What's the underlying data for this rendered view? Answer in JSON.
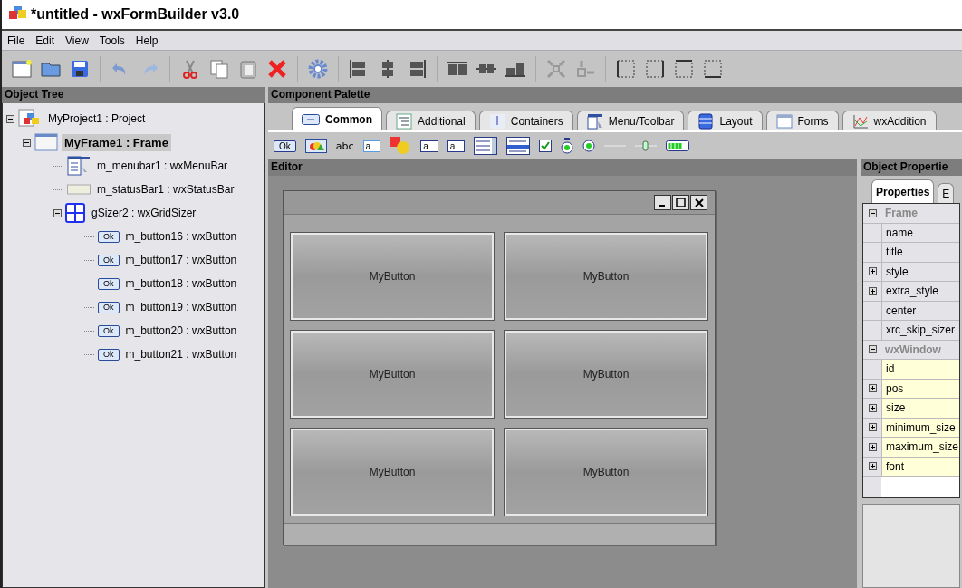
{
  "window": {
    "title": "*untitled - wxFormBuilder v3.0"
  },
  "menu": [
    "File",
    "Edit",
    "View",
    "Tools",
    "Help"
  ],
  "object_tree": {
    "title": "Object Tree",
    "items": [
      {
        "label": "MyProject1 : Project",
        "kind": "project",
        "expanded": true,
        "selected": false,
        "children": [
          {
            "label": "MyFrame1 : Frame",
            "kind": "frame",
            "expanded": true,
            "selected": true,
            "children": [
              {
                "label": "m_menubar1 : wxMenuBar",
                "kind": "menubar",
                "selected": false
              },
              {
                "label": "m_statusBar1 : wxStatusBar",
                "kind": "statusbar",
                "selected": false
              },
              {
                "label": "gSizer2 : wxGridSizer",
                "kind": "sizer",
                "expanded": true,
                "selected": false,
                "children": [
                  {
                    "label": "m_button16 : wxButton",
                    "kind": "button",
                    "badge": "Ok",
                    "selected": false
                  },
                  {
                    "label": "m_button17 : wxButton",
                    "kind": "button",
                    "badge": "Ok",
                    "selected": false
                  },
                  {
                    "label": "m_button18 : wxButton",
                    "kind": "button",
                    "badge": "Ok",
                    "selected": false
                  },
                  {
                    "label": "m_button19 : wxButton",
                    "kind": "button",
                    "badge": "Ok",
                    "selected": false
                  },
                  {
                    "label": "m_button20 : wxButton",
                    "kind": "button",
                    "badge": "Ok",
                    "selected": false
                  },
                  {
                    "label": "m_button21 : wxButton",
                    "kind": "button",
                    "badge": "Ok",
                    "selected": false
                  }
                ]
              }
            ]
          }
        ]
      }
    ]
  },
  "palette": {
    "title": "Component Palette",
    "tabs": [
      {
        "label": "Common",
        "kind": "common",
        "selected": true
      },
      {
        "label": "Additional",
        "kind": "additional",
        "selected": false
      },
      {
        "label": "Containers",
        "kind": "containers",
        "selected": false
      },
      {
        "label": "Menu/Toolbar",
        "kind": "menu",
        "selected": false
      },
      {
        "label": "Layout",
        "kind": "layout",
        "selected": false
      },
      {
        "label": "Forms",
        "kind": "forms",
        "selected": false
      },
      {
        "label": "wxAddition",
        "kind": "additions",
        "selected": false
      }
    ],
    "items": [
      {
        "kind": "button",
        "text": "Ok"
      },
      {
        "kind": "bitmapbutton"
      },
      {
        "kind": "text",
        "text": "abc"
      },
      {
        "kind": "textctrl",
        "text": "a"
      },
      {
        "kind": "bitmap"
      },
      {
        "kind": "combobox",
        "text": "a"
      },
      {
        "kind": "choice",
        "text": "a"
      },
      {
        "kind": "listbox"
      },
      {
        "kind": "listctrl"
      },
      {
        "kind": "checkbox"
      },
      {
        "kind": "radiobutton-group"
      },
      {
        "kind": "radiobutton"
      },
      {
        "kind": "line"
      },
      {
        "kind": "slider"
      },
      {
        "kind": "gauge"
      }
    ]
  },
  "editor": {
    "title": "Editor",
    "frame_buttons": [
      "MyButton",
      "MyButton",
      "MyButton",
      "MyButton",
      "MyButton",
      "MyButton"
    ]
  },
  "properties": {
    "title": "Object Propertie",
    "tabs": [
      {
        "label": "Properties",
        "selected": true
      },
      {
        "label": "E",
        "selected": false
      }
    ],
    "categories": [
      {
        "label": "Frame",
        "expanded": true,
        "color": "#e4e4e8",
        "rows": [
          {
            "label": "name",
            "expanded": null
          },
          {
            "label": "title",
            "expanded": null
          },
          {
            "label": "style",
            "expanded": false
          },
          {
            "label": "extra_style",
            "expanded": false
          },
          {
            "label": "center",
            "expanded": null
          },
          {
            "label": "xrc_skip_sizer",
            "expanded": null
          }
        ]
      },
      {
        "label": "wxWindow",
        "expanded": true,
        "color": "#ffffd8",
        "rows": [
          {
            "label": "id",
            "expanded": null
          },
          {
            "label": "pos",
            "expanded": false
          },
          {
            "label": "size",
            "expanded": false
          },
          {
            "label": "minimum_size",
            "expanded": false
          },
          {
            "label": "maximum_size",
            "expanded": false
          },
          {
            "label": "font",
            "expanded": false
          }
        ]
      }
    ]
  }
}
